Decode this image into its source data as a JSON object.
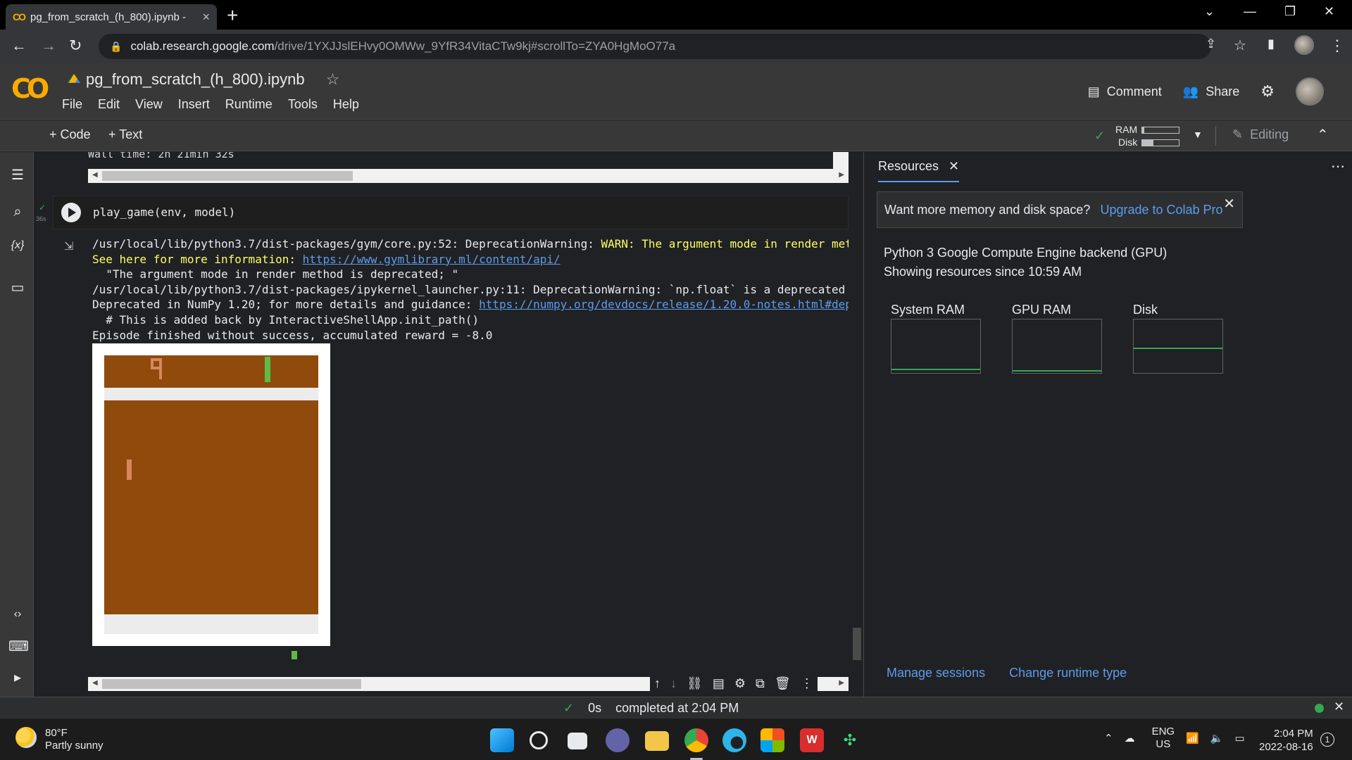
{
  "browser": {
    "tab_title": "pg_from_scratch_(h_800).ipynb -",
    "url_host": "colab.research.google.com",
    "url_path": "/drive/1YXJJslEHvy0OMWw_9YfR34VitaCTw9kj#scrollTo=ZYA0HgMoO77a"
  },
  "colab": {
    "logo_text": "CO",
    "notebook_title": "pg_from_scratch_(h_800).ipynb",
    "menus": [
      "File",
      "Edit",
      "View",
      "Insert",
      "Runtime",
      "Tools",
      "Help"
    ],
    "comment_label": "Comment",
    "share_label": "Share"
  },
  "toolbar": {
    "add_code_label": "+ Code",
    "add_text_label": "+ Text",
    "ram_label": "RAM",
    "disk_label": "Disk",
    "ram_fill": 0.05,
    "disk_fill": 0.3,
    "editing_label": "Editing"
  },
  "notebook": {
    "prev_output": "Wall time: 2h 21min 32s",
    "cell_code": "play_game(env, model)",
    "exec_time": "36s",
    "output_lines": {
      "l1_path": "/usr/local/lib/python3.7/dist-packages/gym/core.py:52: DeprecationWarning: ",
      "l1_warn": "WARN: The argument mode in render met",
      "l2_text": "See here for more information: ",
      "l2_link": "https://www.gymlibrary.ml/content/api/",
      "l3": "  \"The argument mode in render method is deprecated; \"",
      "l4": "/usr/local/lib/python3.7/dist-packages/ipykernel_launcher.py:11: DeprecationWarning: `np.float` is a deprecated",
      "l5_text": "Deprecated in NumPy 1.20; for more details and guidance: ",
      "l5_link": "https://numpy.org/devdocs/release/1.20.0-notes.html#dep",
      "l6": "  # This is added back by InteractiveShellApp.init_path()",
      "l7": "Episode finished without success, accumulated reward = -8.0"
    }
  },
  "resources": {
    "tab_label": "Resources",
    "upgrade_text": "Want more memory and disk space?",
    "upgrade_link": "Upgrade to Colab Pro",
    "backend_line1": "Python 3 Google Compute Engine backend (GPU)",
    "backend_line2": "Showing resources since 10:59 AM",
    "gauges": [
      {
        "label": "System RAM",
        "level": 0.05
      },
      {
        "label": "GPU RAM",
        "level": 0.02
      },
      {
        "label": "Disk",
        "level": 0.45
      }
    ],
    "manage_sessions": "Manage sessions",
    "change_runtime": "Change runtime type"
  },
  "status": {
    "check": "✓",
    "duration": "0s",
    "completed": "completed at 2:04 PM"
  },
  "taskbar": {
    "temperature": "80°F",
    "weather": "Partly sunny",
    "lang1": "ENG",
    "lang2": "US",
    "time": "2:04 PM",
    "date": "2022-08-16",
    "notifications": "1"
  },
  "colors": {
    "colab_orange": "#f9ab00",
    "link_blue": "#5d9cec",
    "warn_yellow": "#ffff66",
    "game_brown": "#904a0b",
    "game_green": "#5cba47",
    "status_green": "#34a853"
  }
}
